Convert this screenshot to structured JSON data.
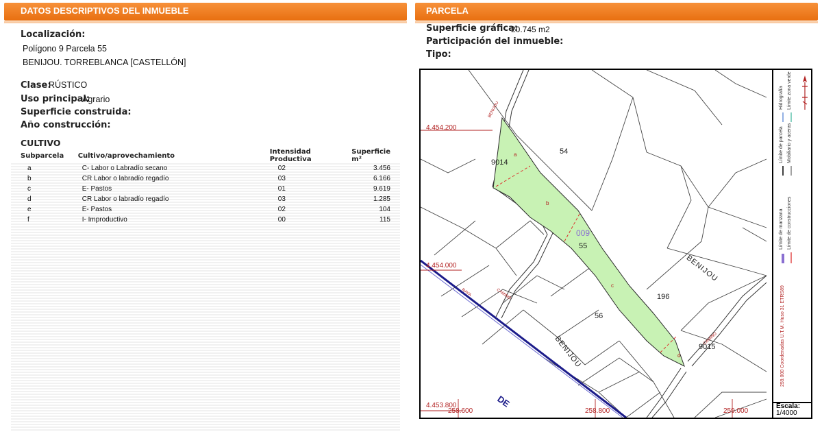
{
  "left_header": "DATOS DESCRIPTIVOS DEL INMUEBLE",
  "right_header": "PARCELA",
  "localizacion": {
    "label": "Localización:",
    "line1": "Polígono 9 Parcela 55",
    "line2": "BENIJOU. TORREBLANCA [CASTELLÓN]"
  },
  "clase": {
    "label": "Clase:",
    "value": "RÚSTICO"
  },
  "uso": {
    "label": "Uso principal:",
    "value": "Agrario"
  },
  "superficie_construida": {
    "label": "Superficie construida:"
  },
  "ano": {
    "label": "Año construcción:"
  },
  "cultivo": {
    "title": "CULTIVO",
    "headers": [
      "Subparcela",
      "Cultivo/aprovechamiento",
      "Intensidad Productiva",
      "Superficie m²"
    ],
    "rows": [
      [
        "a",
        "C- Labor o Labradío secano",
        "02",
        "3.456"
      ],
      [
        "b",
        "CR Labor o labradío regadío",
        "03",
        "6.166"
      ],
      [
        "c",
        "E- Pastos",
        "01",
        "9.619"
      ],
      [
        "d",
        "CR Labor o labradío regadío",
        "03",
        "1.285"
      ],
      [
        "e",
        "E- Pastos",
        "02",
        "104"
      ],
      [
        "f",
        "I- Improductivo",
        "00",
        "115"
      ]
    ]
  },
  "parcela": {
    "superficie_label": "Superficie gráfica:",
    "superficie_value": "20.745 m2",
    "participacion_label": "Participación del inmueble:",
    "tipo_label": "Tipo:"
  },
  "map": {
    "coords": {
      "y_top": "4.454.200",
      "y_mid": "4.454.000",
      "y_bottom": "4.453.800",
      "x_left": "258.600",
      "x_mid": "258.800",
      "x_right": "259.000"
    },
    "parcel_numbers": [
      "54",
      "9014",
      "55",
      "56",
      "196",
      "9015"
    ],
    "highlight_number": "009",
    "subparcel_letters": [
      "a",
      "b",
      "c",
      "d"
    ],
    "place_names": [
      "BENIJOU",
      "BENIJOU",
      "DE"
    ],
    "road_labels": [
      "BENIJOU",
      "CAMINO",
      "RAYA",
      "CAMINO"
    ],
    "parcel_fill_color": "#c8f2b4",
    "coord_color": "#b22222",
    "highlight_color": "#8a6fd1"
  },
  "legend": {
    "items": [
      "Límite de manzana",
      "Límite de parcela",
      "Hidrografía",
      "Límite de construcciones",
      "Mobiliario y aceras",
      "Límite zona verde"
    ],
    "coords_note": "259.000 Coordenadas U.T.M. Huso 31 ETRS89",
    "escala_label": "Escala:",
    "escala_value": "1/4000",
    "north_icon": "north-arrow-icon"
  }
}
